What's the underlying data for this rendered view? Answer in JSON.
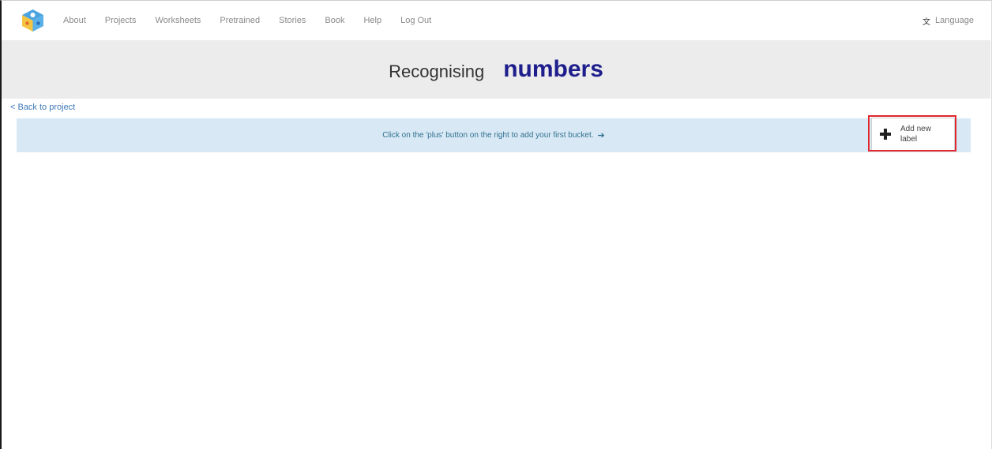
{
  "nav": {
    "logo_icon": "cube-logo-icon",
    "links": [
      "About",
      "Projects",
      "Worksheets",
      "Pretrained",
      "Stories",
      "Book",
      "Help",
      "Log Out"
    ],
    "language_label": "Language",
    "language_icon": "translate-icon"
  },
  "header": {
    "prefix": "Recognising",
    "project_name": "numbers"
  },
  "back_link": "< Back to project",
  "info": {
    "message": "Click on the 'plus' button on the right to add your first bucket.",
    "arrow_icon": "arrow-right-icon"
  },
  "add_label_button": {
    "line1": "Add new",
    "line2": "label",
    "icon": "plus-icon"
  },
  "colors": {
    "title_accent": "#1e1e8c",
    "info_background": "#d8e9f5",
    "highlight_border": "#e0282e",
    "link": "#3f7ab7"
  }
}
